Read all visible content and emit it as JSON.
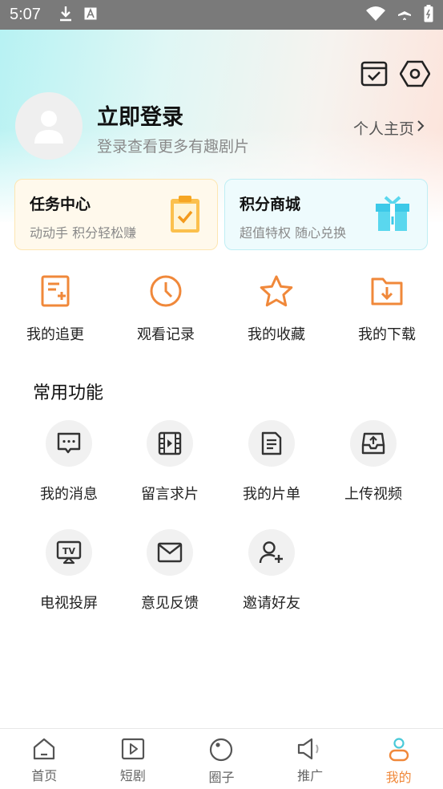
{
  "status_bar": {
    "time": "5:07",
    "left_icons": [
      "download-icon",
      "font-a-icon"
    ],
    "right_icons": [
      "wifi-icon",
      "airplane-icon",
      "battery-icon"
    ]
  },
  "header": {
    "top_icons": [
      "check-calendar-icon",
      "settings-hex-icon"
    ],
    "login_title": "立即登录",
    "login_subtitle": "登录查看更多有趣剧片",
    "profile_link": "个人主页"
  },
  "cards": [
    {
      "title": "任务中心",
      "subtitle": "动动手 积分轻松赚",
      "icon": "clipboard-check-icon"
    },
    {
      "title": "积分商城",
      "subtitle": "超值特权 随心兑换",
      "icon": "gift-icon"
    }
  ],
  "quick_actions": [
    {
      "label": "我的追更",
      "icon": "doc-plus-icon"
    },
    {
      "label": "观看记录",
      "icon": "clock-icon"
    },
    {
      "label": "我的收藏",
      "icon": "star-icon"
    },
    {
      "label": "我的下载",
      "icon": "folder-download-icon"
    }
  ],
  "common": {
    "title": "常用功能",
    "items": [
      {
        "label": "我的消息",
        "icon": "message-icon"
      },
      {
        "label": "留言求片",
        "icon": "film-icon"
      },
      {
        "label": "我的片单",
        "icon": "list-doc-icon"
      },
      {
        "label": "上传视频",
        "icon": "upload-tray-icon"
      },
      {
        "label": "电视投屏",
        "icon": "tv-cast-icon"
      },
      {
        "label": "意见反馈",
        "icon": "mail-icon"
      },
      {
        "label": "邀请好友",
        "icon": "add-user-icon"
      }
    ]
  },
  "tabbar": {
    "active": "我的",
    "active_color": "#f0883a",
    "tabs": [
      {
        "label": "首页",
        "icon": "home-icon"
      },
      {
        "label": "短剧",
        "icon": "play-square-icon"
      },
      {
        "label": "圈子",
        "icon": "circle-icon"
      },
      {
        "label": "推广",
        "icon": "speaker-icon"
      },
      {
        "label": "我的",
        "icon": "person-icon"
      }
    ]
  },
  "colors": {
    "accent": "#f0883a",
    "task_card_bg": "#fff9ec",
    "points_card_bg": "#eefbfd"
  }
}
